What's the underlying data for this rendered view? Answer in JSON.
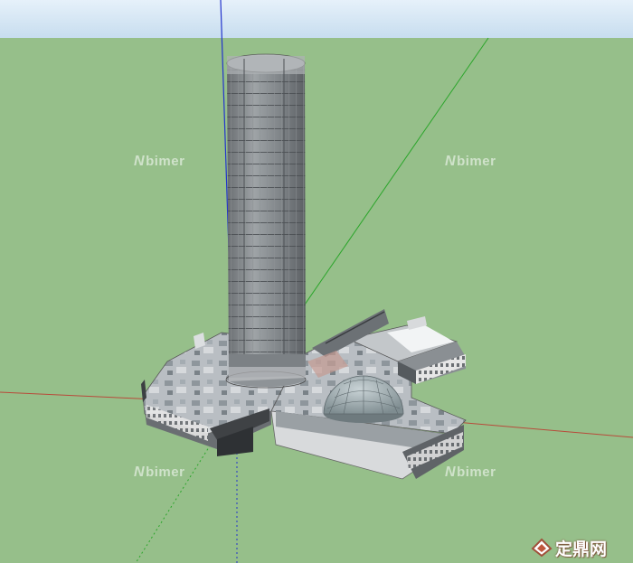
{
  "scene": {
    "sky_color": "#cfe3f3",
    "ground_color": "#96bf8a",
    "axes": {
      "blue": "#2233cc",
      "green": "#2aa52a",
      "red": "#b84a3a"
    }
  },
  "watermarks": [
    {
      "n": "N",
      "text": "bimer"
    },
    {
      "n": "N",
      "text": "bimer"
    },
    {
      "n": "N",
      "text": "bimer"
    },
    {
      "n": "N",
      "text": "bimer"
    }
  ],
  "logo": {
    "text": "定鼎网"
  }
}
